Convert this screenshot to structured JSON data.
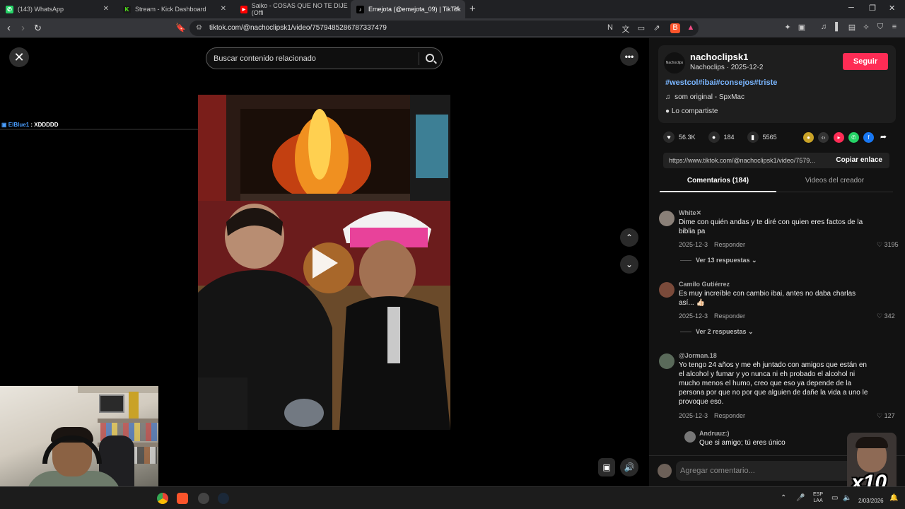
{
  "browser": {
    "tabs": [
      {
        "label": "(143) WhatsApp",
        "icon": "whatsapp-icon",
        "active": false
      },
      {
        "label": "Stream - Kick Dashboard",
        "icon": "kick-icon",
        "active": false
      },
      {
        "label": "Saiko - COSAS QUE NO TE DIJE (Offi",
        "icon": "youtube-icon",
        "active": false
      },
      {
        "label": "Emejota (@emejota_09) | TikTok",
        "icon": "tiktok-icon",
        "active": true
      }
    ],
    "url": "tiktok.com/@nachoclipsk1/video/7579485286787337479"
  },
  "stream": {
    "chat_user": "ElBlue1",
    "chat_message": ": XDDDDD"
  },
  "video": {
    "search_placeholder": "Buscar contenido relacionado"
  },
  "author": {
    "avatar_text": "Nachoclips",
    "username": "nachoclipsk1",
    "subtitle": "Nachoclips · 2025-12-2",
    "follow_label": "Seguir",
    "hashtags": "#westcol#ibai#consejos#triste",
    "sound": "som original - SpxMac",
    "shared": "Lo compartiste"
  },
  "stats": {
    "likes": "56.3K",
    "comments": "184",
    "saves": "5565"
  },
  "link": {
    "url": "https://www.tiktok.com/@nachoclipsk1/video/7579...",
    "copy_label": "Copiar enlace"
  },
  "panel_tabs": {
    "comments": "Comentarios (184)",
    "creator_videos": "Videos del creador"
  },
  "comments": [
    {
      "user": "White✕",
      "text": "Dime con quién andas y te diré con quien eres factos de la biblia pa",
      "date": "2025-12-3",
      "reply": "Responder",
      "likes": "3195",
      "more": "Ver 13 respuestas ⌄"
    },
    {
      "user": "Camilo Gutiérrez",
      "text": "Es muy increíble con cambio ibai, antes no daba charlas así... 👍🏻",
      "date": "2025-12-3",
      "reply": "Responder",
      "likes": "342",
      "more": "Ver 2 respuestas ⌄"
    },
    {
      "user": "@Jorman.18",
      "text": "Yo tengo 24 años y me eh juntado con amigos que están en el alcohol y fumar y yo nunca ni eh probado el alcohol ni mucho menos el humo, creo que eso ya depende de la persona por que no por que alguien de dañe la vida a uno le provoque eso.",
      "date": "2025-12-3",
      "reply": "Responder",
      "likes": "127"
    }
  ],
  "reply_preview": {
    "user": "Andruuz:)",
    "text": "Que si amigo; tú eres único"
  },
  "comment_input_placeholder": "Agregar comentario...",
  "overlay_badge": "x10",
  "taskbar": {
    "lang_line1": "ESP",
    "lang_line2": "LAA",
    "date": "2/03/2026"
  }
}
